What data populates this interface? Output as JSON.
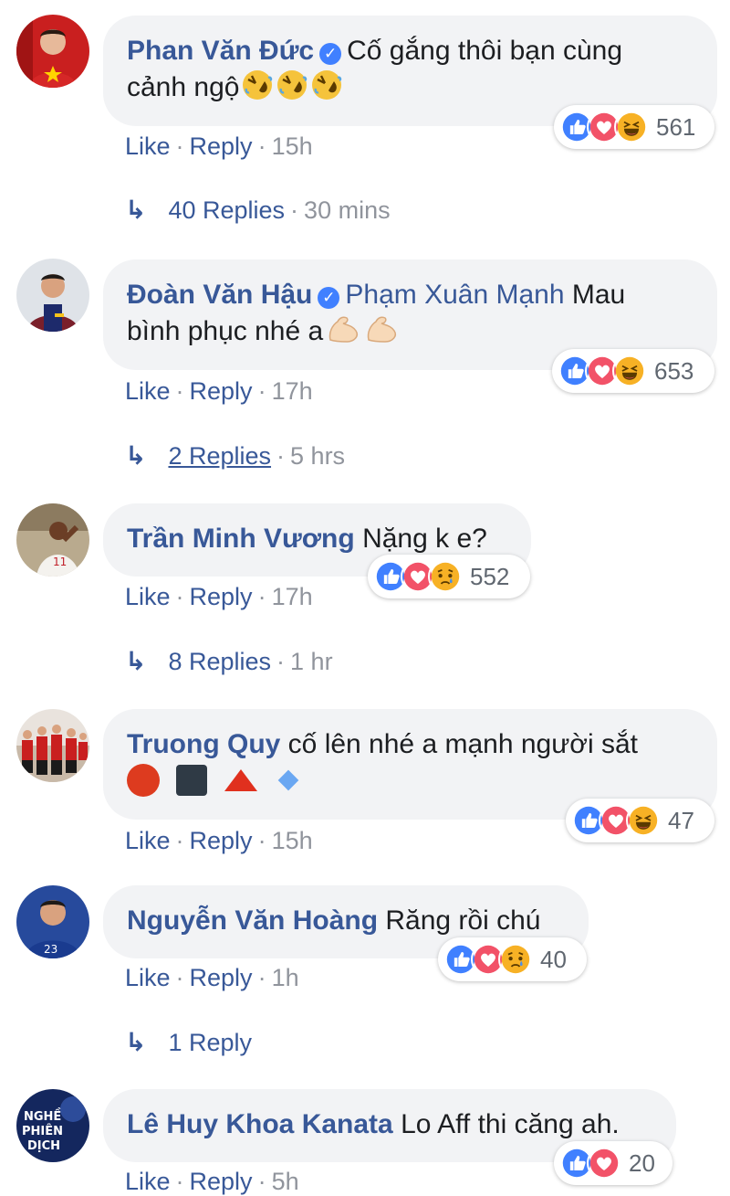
{
  "comments": [
    {
      "author": "Phan Văn Đức",
      "verified": true,
      "mention": "",
      "text": "Cố gắng thôi bạn cùng",
      "text2": "cảnh ngộ",
      "emojis": [
        "rofl",
        "rofl",
        "rofl"
      ],
      "reactions": [
        "like",
        "love",
        "haha"
      ],
      "reaction_count": "561",
      "like": "Like",
      "reply": "Reply",
      "time": "15h",
      "replies_label": "40 Replies",
      "replies_time": "30 mins"
    },
    {
      "author": "Đoàn Văn Hậu",
      "verified": true,
      "mention": "Phạm Xuân Mạnh",
      "text": "Mau",
      "text2": "bình phục nhé a",
      "emojis": [
        "muscle",
        "muscle"
      ],
      "reactions": [
        "like",
        "love",
        "haha"
      ],
      "reaction_count": "653",
      "like": "Like",
      "reply": "Reply",
      "time": "17h",
      "replies_label": "2 Replies",
      "replies_time": "5 hrs"
    },
    {
      "author": "Trần Minh Vương",
      "verified": false,
      "text": "Nặng k e?",
      "reactions": [
        "like",
        "love",
        "sad"
      ],
      "reaction_count": "552",
      "like": "Like",
      "reply": "Reply",
      "time": "17h",
      "replies_label": "8 Replies",
      "replies_time": "1 hr"
    },
    {
      "author": "Truong Quy",
      "verified": false,
      "text": "cố lên nhé a mạnh người sắt",
      "shapes": [
        "red-circle",
        "black-square",
        "red-triangle",
        "blue-diamond"
      ],
      "reactions": [
        "like",
        "love",
        "haha"
      ],
      "reaction_count": "47",
      "like": "Like",
      "reply": "Reply",
      "time": "15h"
    },
    {
      "author": "Nguyễn Văn Hoàng",
      "verified": false,
      "text": "Răng rồi chú",
      "reactions": [
        "like",
        "love",
        "sad"
      ],
      "reaction_count": "40",
      "like": "Like",
      "reply": "Reply",
      "time": "1h",
      "replies_label": "1 Reply",
      "replies_time": ""
    },
    {
      "author": "Lê Huy Khoa Kanata",
      "verified": false,
      "text": "Lo Aff thi căng ah.",
      "reactions": [
        "like",
        "love"
      ],
      "reaction_count": "20",
      "like": "Like",
      "reply": "Reply",
      "time": "5h"
    }
  ],
  "avatar6_text": [
    "NGHỀ",
    "PHIÊN",
    "DỊCH"
  ],
  "colors": {
    "link": "#385898",
    "meta": "#90949c",
    "bubble": "#f2f3f5",
    "like": "#4080ff",
    "love": "#f25268",
    "haha": "#f7b125"
  }
}
